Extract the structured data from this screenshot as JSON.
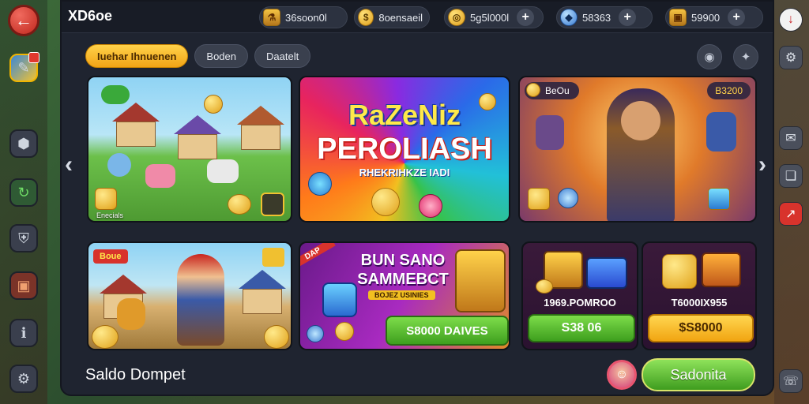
{
  "header": {
    "logo": "XD6oe",
    "currencies": [
      {
        "icon": "potion-icon",
        "value": "36soon0l"
      },
      {
        "icon": "gold-coin-icon",
        "value": "8oensaeil"
      },
      {
        "icon": "coin-icon",
        "value": "5g5l000l"
      },
      {
        "icon": "gem-icon",
        "value": "58363"
      },
      {
        "icon": "chest-icon",
        "value": "59900"
      }
    ]
  },
  "tabs": [
    {
      "label": "Iuehar Ihnuenen",
      "active": true
    },
    {
      "label": "Boden"
    },
    {
      "label": "Daatelt"
    }
  ],
  "cards": {
    "farm": {
      "label": "Enecials"
    },
    "puzzle": {
      "title1": "RaZeNiz",
      "title2": "PEROLIASH",
      "subtitle": "RHEKRIHKZE IADI"
    },
    "hero": {
      "badge_left": "BeOu",
      "badge_right": "B3200"
    },
    "warrior": {
      "badge": "Boue"
    },
    "bonus": {
      "ribbon": "DAP",
      "title1": "BUN SANO",
      "title2": "SAMMEBCT",
      "tag": "BOJEZ USINIES",
      "button": "S8000 DAIVES"
    },
    "pack1": {
      "title": "1969.POMROO",
      "button": "S38 06"
    },
    "pack2": {
      "title": "T6000IX955",
      "button": "$S8000"
    }
  },
  "footer": {
    "title": "Saldo Dompet",
    "confirm": "Sadonita"
  },
  "colors": {
    "accent_yellow": "#f2a416",
    "accent_green": "#3f9d1f",
    "panel": "#1f2430"
  }
}
